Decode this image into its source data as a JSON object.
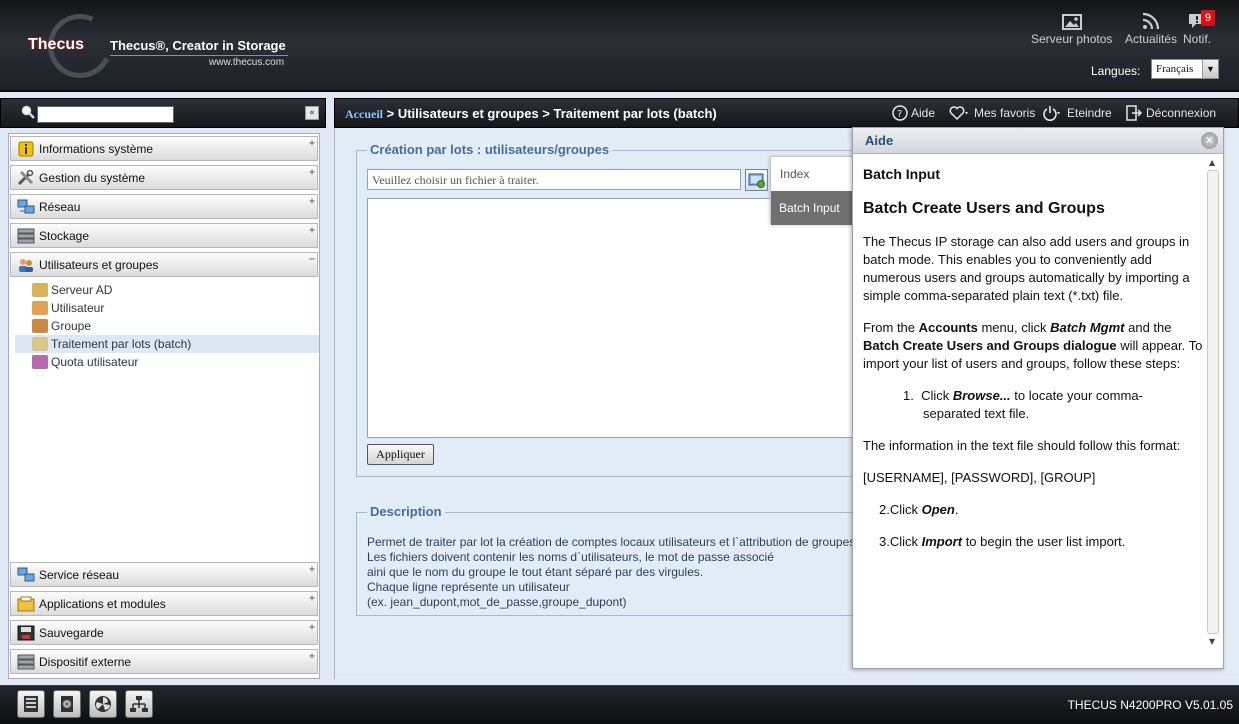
{
  "header": {
    "brand_mark": "Thecus",
    "slogan": "Thecus®, Creator in Storage",
    "url": "www.thecus.com",
    "photos_label": "Serveur photos",
    "news_label": "Actualités",
    "notif_label": "Notif.",
    "notif_count": "9",
    "languages_label": "Langues:",
    "language_value": "Français"
  },
  "breadcrumb": {
    "home": "Accueil",
    "path": " > Utilisateurs et groupes > Traitement par lots (batch)"
  },
  "toolbar": {
    "help": "Aide",
    "favorites": "Mes favoris",
    "shutdown": "Eteindre",
    "logout": "Déconnexion"
  },
  "sidebar": {
    "categories_top": [
      {
        "label": "Informations système",
        "icon": "info-icon"
      },
      {
        "label": "Gestion du système",
        "icon": "tools-icon"
      },
      {
        "label": "Réseau",
        "icon": "network-icon"
      },
      {
        "label": "Stockage",
        "icon": "storage-icon"
      },
      {
        "label": "Utilisateurs et groupes",
        "icon": "users-icon"
      }
    ],
    "sub_items": [
      {
        "label": "Serveur AD"
      },
      {
        "label": "Utilisateur"
      },
      {
        "label": "Groupe"
      },
      {
        "label": "Traitement par lots (batch)"
      },
      {
        "label": "Quota utilisateur"
      }
    ],
    "categories_bottom": [
      {
        "label": "Service réseau"
      },
      {
        "label": "Applications et modules"
      },
      {
        "label": "Sauvegarde"
      },
      {
        "label": "Dispositif externe"
      }
    ]
  },
  "main": {
    "batch_legend": "Création par lots : utilisateurs/groupes",
    "file_placeholder": "Veuillez choisir un fichier à traiter.",
    "apply_label": "Appliquer",
    "desc_legend": "Description",
    "desc_lines": [
      "Permet de traiter par lot la création de comptes locaux utilisateurs et l`attribution de groupes.",
      "Les fichiers doivent contenir les noms d`utilisateurs, le mot de passe associé",
      "aini que le nom du groupe le tout étant séparé par des virgules.",
      "Chaque ligne représente un utilisateur",
      "(ex. jean_dupont,mot_de_passe,groupe_dupont)"
    ]
  },
  "index_popup": {
    "index": "Index",
    "batch_input": "Batch Input"
  },
  "help": {
    "title": "Aide",
    "h1": "Batch Input",
    "h2": "Batch Create Users and Groups",
    "p1": "The Thecus IP storage can also add users and groups in batch mode. This enables you to conveniently add numerous users and groups automatically by importing a simple comma-separated plain text (*.txt) file.",
    "p2_a": "From the ",
    "p2_accounts": "Accounts",
    "p2_b": " menu, click ",
    "p2_batch": "Batch Mgmt",
    "p2_c": " and the ",
    "p2_dialog": "Batch Create Users and Groups dialogue",
    "p2_d": " will appear. To import your list of users and groups, follow these steps:",
    "step1_a": "Click ",
    "step1_browse": "Browse...",
    "step1_b": " to locate your comma-separated text file.",
    "p3": "The information in the text file should follow this format:",
    "format": "[USERNAME], [PASSWORD], [GROUP]",
    "step2_a": "2.Click ",
    "step2_open": "Open",
    "step2_b": ".",
    "step3_a": "3.Click ",
    "step3_import": "Import",
    "step3_b": " to begin the user list import."
  },
  "footer": {
    "version": "THECUS N4200PRO V5.01.05"
  },
  "colors": {
    "accent": "#4b6c95",
    "notif": "#dd1111",
    "header_bg": "#1d2026"
  }
}
